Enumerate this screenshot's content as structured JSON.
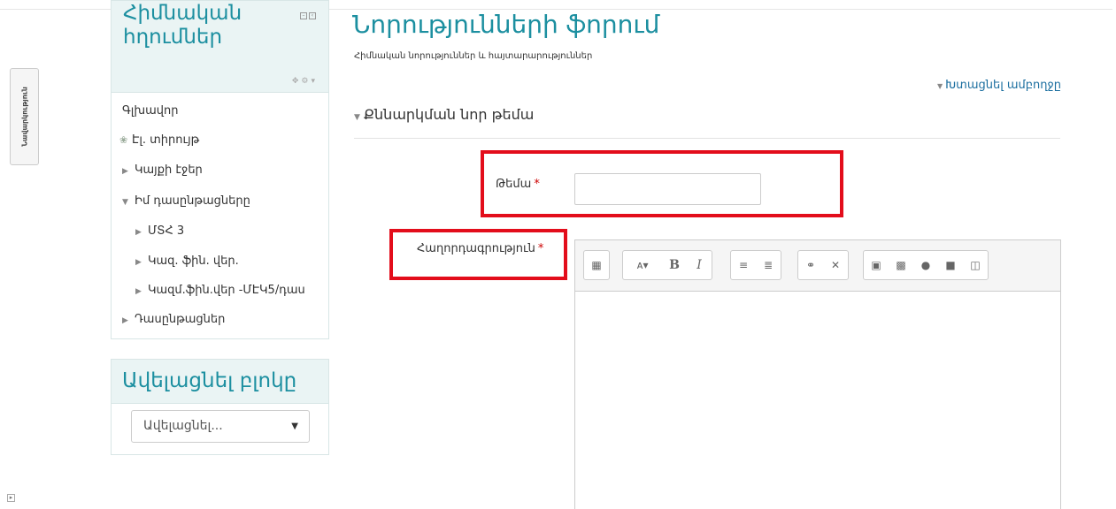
{
  "dock": {
    "tab_label": "Նավարկություն"
  },
  "nav_block": {
    "title": "Հիմնական հղումներ",
    "items": [
      {
        "label": "Գլխավոր",
        "icon": "none"
      },
      {
        "label": "Էլ. տիրույթ",
        "icon": "dashboard-icon"
      },
      {
        "label": "Կայքի էջեր",
        "icon": "arrow-right"
      },
      {
        "label": "Իմ դասընթացները",
        "icon": "arrow-down"
      },
      {
        "label": "ՄՏՀ 3",
        "icon": "arrow-right"
      },
      {
        "label": "Կազ. ֆին. վեր.",
        "icon": "arrow-right"
      },
      {
        "label": "Կազմ.ֆին.վեր -ՄԷԿ5/դաս",
        "icon": "arrow-right"
      },
      {
        "label": "Դասընթացներ",
        "icon": "arrow-right"
      }
    ]
  },
  "add_block": {
    "title": "Ավելացնել բլոկը",
    "select_value": "Ավելացնել..."
  },
  "main": {
    "title": "Նորությունների ֆորում",
    "subtitle": "Հիմնական նորություններ և հայտարարություններ",
    "collapse_all": "Խտացնել ամբողջը",
    "legend": "Քննարկման նոր թեմա",
    "subject_label": "Թեմա",
    "message_label": "Հաղորդագրություն",
    "required_mark": "*"
  },
  "colors": {
    "accent": "#1c8fa0",
    "highlight": "#e30d1b",
    "required": "#cc0000"
  }
}
